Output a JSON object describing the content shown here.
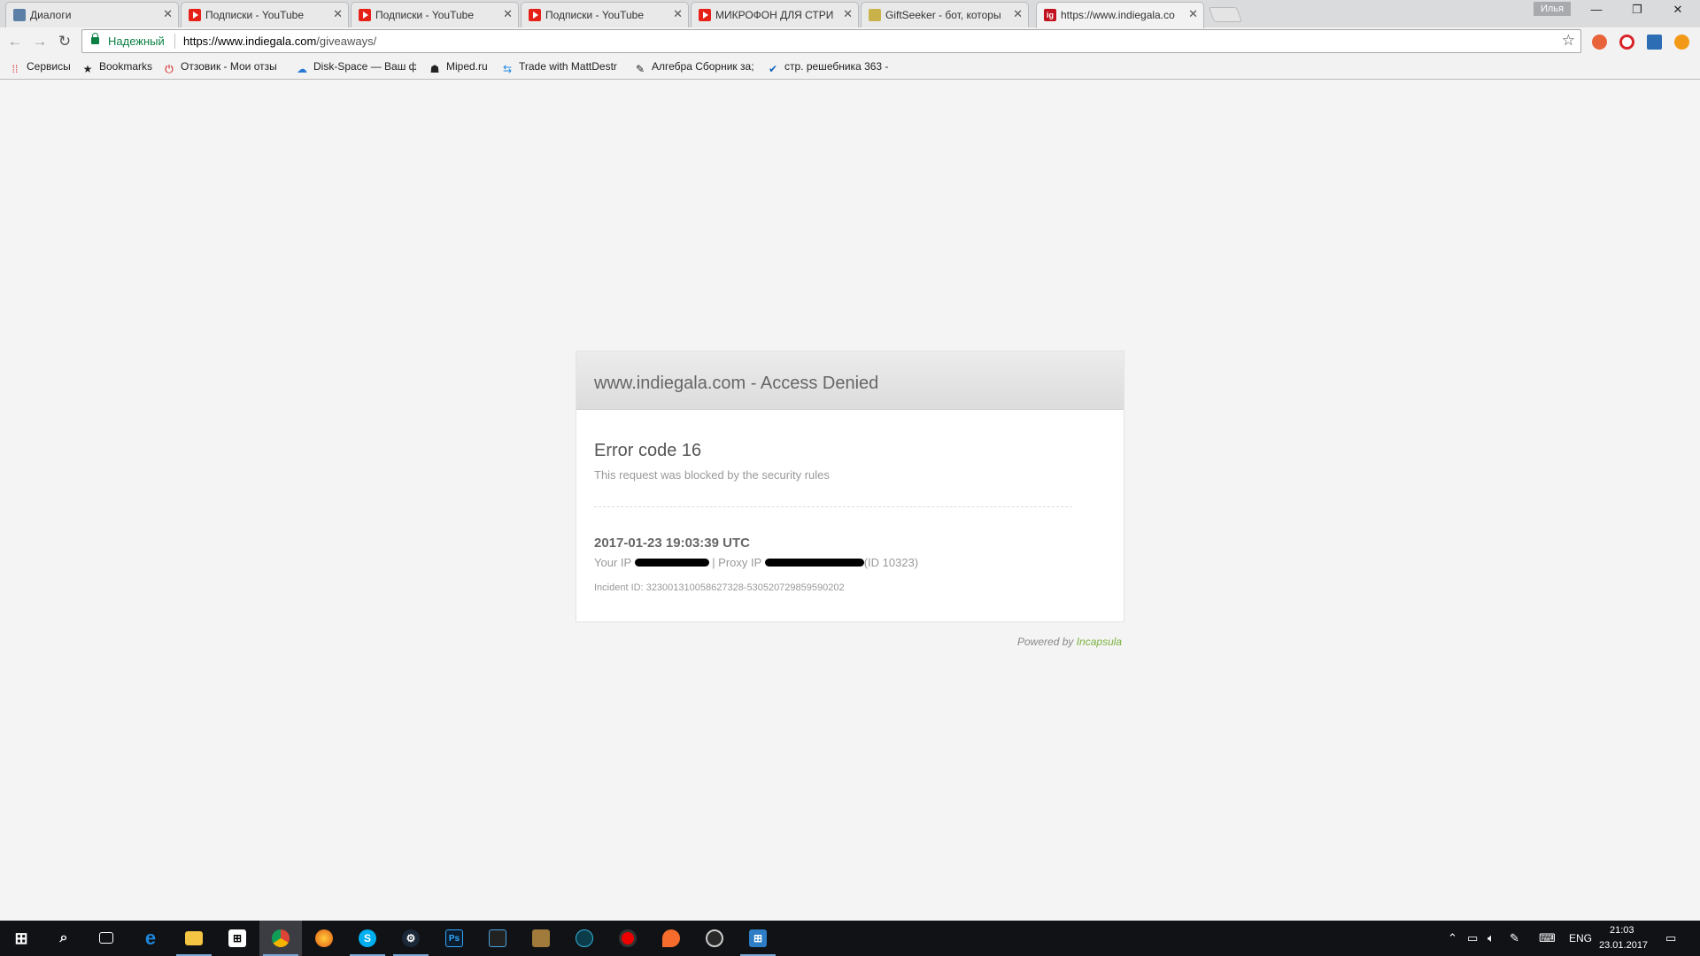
{
  "browser": {
    "tabs": [
      {
        "title": "Диалоги",
        "favicon": "vk-icon",
        "active": false
      },
      {
        "title": "Подписки - YouTube",
        "favicon": "youtube-icon",
        "active": false
      },
      {
        "title": "Подписки - YouTube",
        "favicon": "youtube-icon",
        "active": false
      },
      {
        "title": "Подписки - YouTube",
        "favicon": "youtube-icon",
        "active": false
      },
      {
        "title": "МИКРОФОН ДЛЯ СТРИ",
        "favicon": "youtube-icon",
        "active": false
      },
      {
        "title": "GiftSeeker - бот, которы",
        "favicon": "giftseeker-icon",
        "active": false
      },
      {
        "title": "https://www.indiegala.co",
        "favicon": "indiegala-icon",
        "active": true
      }
    ],
    "profile_name": "Илья",
    "security_label": "Надежный",
    "url_host": "https://www.indiegala.com",
    "url_path": "/giveaways/",
    "bookmarks": [
      {
        "label": "Сервисы",
        "icon": "apps-grid-icon"
      },
      {
        "label": "Bookmarks",
        "icon": "star-icon"
      },
      {
        "label": "Отзовик - Мои отзы",
        "icon": "otzovik-icon"
      },
      {
        "label": "Disk-Space — Ваш ф",
        "icon": "cloud-icon"
      },
      {
        "label": "Miped.ru",
        "icon": "miped-icon"
      },
      {
        "label": "Trade with MattDestr",
        "icon": "trade-icon"
      },
      {
        "label": "Алгебра Сборник за;",
        "icon": "pen-icon"
      },
      {
        "label": "стр. решебника 363 -",
        "icon": "check-icon"
      }
    ]
  },
  "page": {
    "title": "www.indiegala.com - Access Denied",
    "error_code": "Error code 16",
    "error_description": "This request was blocked by the security rules",
    "timestamp": "2017-01-23 19:03:39 UTC",
    "your_ip_label": "Your IP",
    "proxy_ip_label": "| Proxy IP",
    "proxy_id": "(ID 10323)",
    "incident": "Incident ID: 323001310058627328-530520729859590202",
    "powered_by": "Powered by",
    "powered_brand": "Incapsula"
  },
  "taskbar": {
    "apps": [
      "start-icon",
      "search-icon",
      "task-view-icon",
      "edge-icon",
      "file-explorer-icon",
      "store-icon",
      "chrome-icon",
      "firefox-icon",
      "skype-icon",
      "steam-icon",
      "photoshop-icon",
      "video-editor-icon",
      "game-icon",
      "app-icon",
      "recorder-icon",
      "origin-icon",
      "obs-icon",
      "gift-icon"
    ],
    "language": "ENG",
    "time": "21:03",
    "date": "23.01.2017"
  },
  "colors": {
    "secure_green": "#0b8043",
    "incapsula_green": "#7cb342",
    "taskbar_bg": "#101216"
  }
}
